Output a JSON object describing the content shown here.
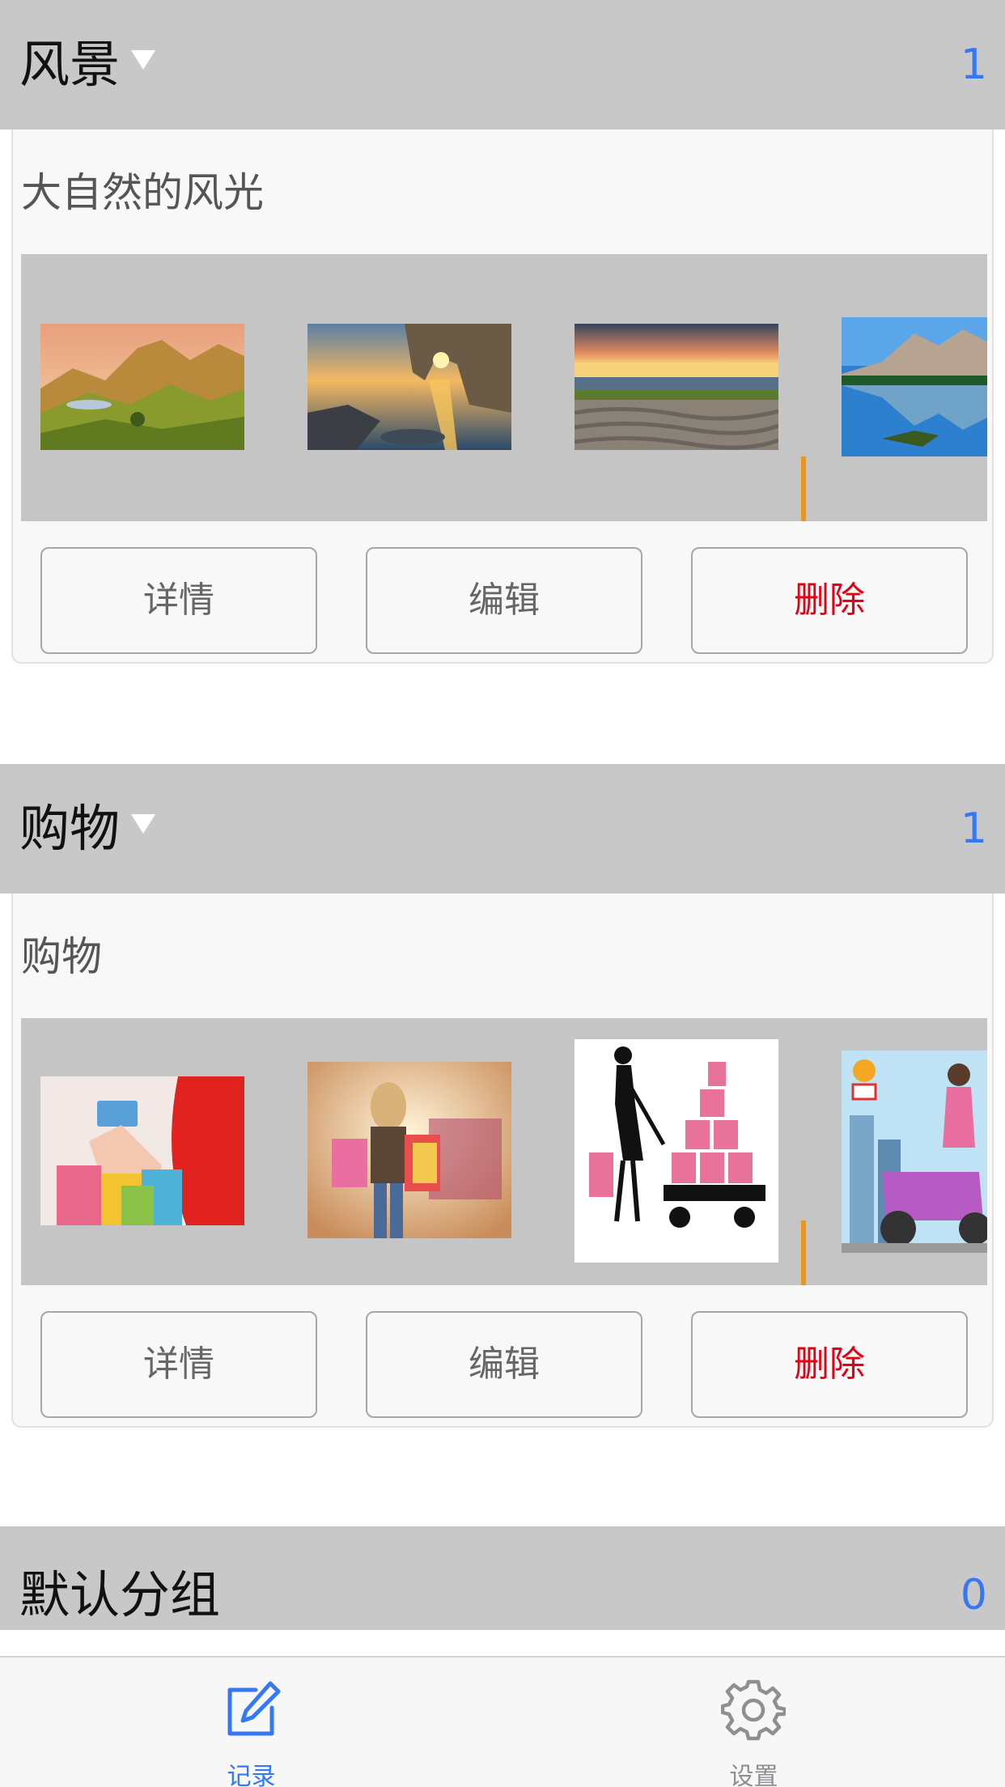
{
  "groups": [
    {
      "title": "风景",
      "count": "1",
      "description": "大自然的风光",
      "images": [
        "mountain-landscape",
        "sea-rock-arch-sunset",
        "beach-sunset",
        "lake-mountain-reflection"
      ]
    },
    {
      "title": "购物",
      "count": "1",
      "description": "购物",
      "images": [
        "shopping-bags-card",
        "woman-with-shopping-bags",
        "woman-with-gift-cart",
        "woman-on-scooter"
      ]
    },
    {
      "title": "默认分组",
      "count": "0"
    }
  ],
  "actions": {
    "detail_label": "详情",
    "edit_label": "编辑",
    "delete_label": "删除"
  },
  "tabbar": {
    "items": [
      {
        "label": "记录",
        "icon": "edit-icon",
        "active": true
      },
      {
        "label": "设置",
        "icon": "gear-icon",
        "active": false
      }
    ]
  },
  "colors": {
    "accent": "#3478f6",
    "danger": "#e60012",
    "indicator": "#f0951c",
    "header_bg": "#c8c8c8",
    "gallery_bg": "#c5c5c5"
  }
}
